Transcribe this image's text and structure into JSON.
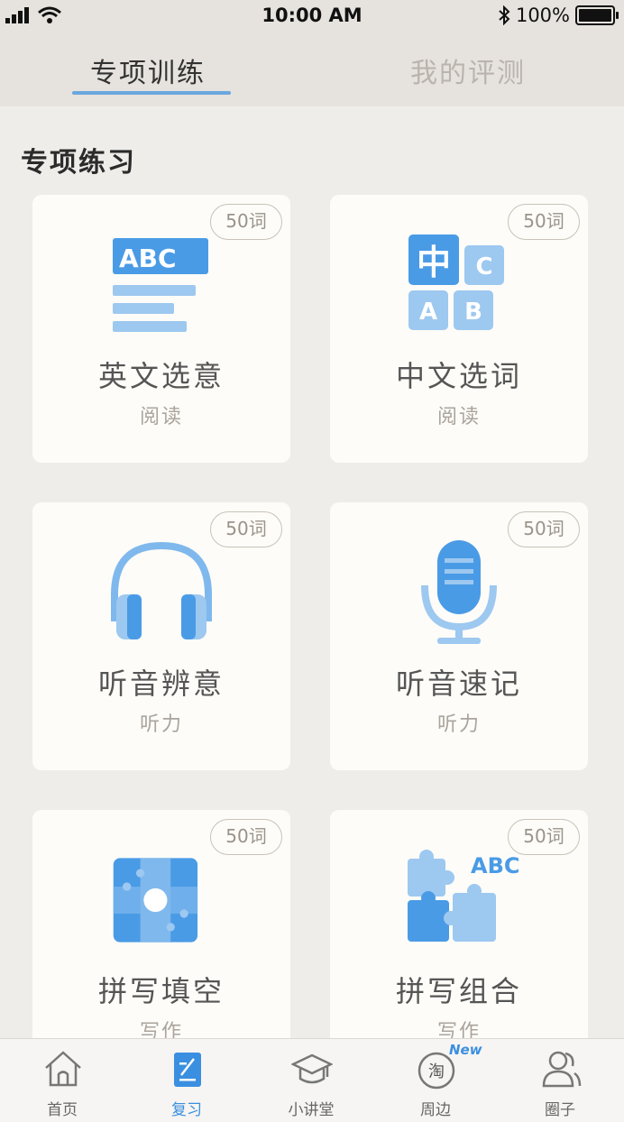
{
  "status_bar": {
    "time": "10:00 AM",
    "battery": "100%"
  },
  "top_tabs": [
    {
      "label": "专项训练",
      "active": true
    },
    {
      "label": "我的评测",
      "active": false
    }
  ],
  "section_title": "专项练习",
  "cards": [
    {
      "title": "英文选意",
      "subtitle": "阅读",
      "badge": "50词",
      "icon": "abc-text-icon",
      "icon_text": "ABC"
    },
    {
      "title": "中文选词",
      "subtitle": "阅读",
      "badge": "50词",
      "icon": "chinese-blocks-icon",
      "icon_text": [
        "中",
        "C",
        "A",
        "B"
      ]
    },
    {
      "title": "听音辨意",
      "subtitle": "听力",
      "badge": "50词",
      "icon": "headphones-icon"
    },
    {
      "title": "听音速记",
      "subtitle": "听力",
      "badge": "50词",
      "icon": "microphone-icon"
    },
    {
      "title": "拼写填空",
      "subtitle": "写作",
      "badge": "50词",
      "icon": "puzzle-grid-icon"
    },
    {
      "title": "拼写组合",
      "subtitle": "写作",
      "badge": "50词",
      "icon": "puzzle-abc-icon",
      "icon_text": "ABC"
    }
  ],
  "bottom_nav": [
    {
      "label": "首页",
      "icon": "home-icon",
      "active": false
    },
    {
      "label": "复习",
      "icon": "review-icon",
      "active": true
    },
    {
      "label": "小讲堂",
      "icon": "graduation-cap-icon",
      "active": false
    },
    {
      "label": "周边",
      "icon": "taobao-icon",
      "active": false,
      "badge": "New",
      "icon_text": "淘"
    },
    {
      "label": "圈子",
      "icon": "people-icon",
      "active": false
    }
  ],
  "colors": {
    "accent": "#3a8fe0",
    "icon_light": "#9dc8f0",
    "icon_dark": "#4a9be6"
  }
}
